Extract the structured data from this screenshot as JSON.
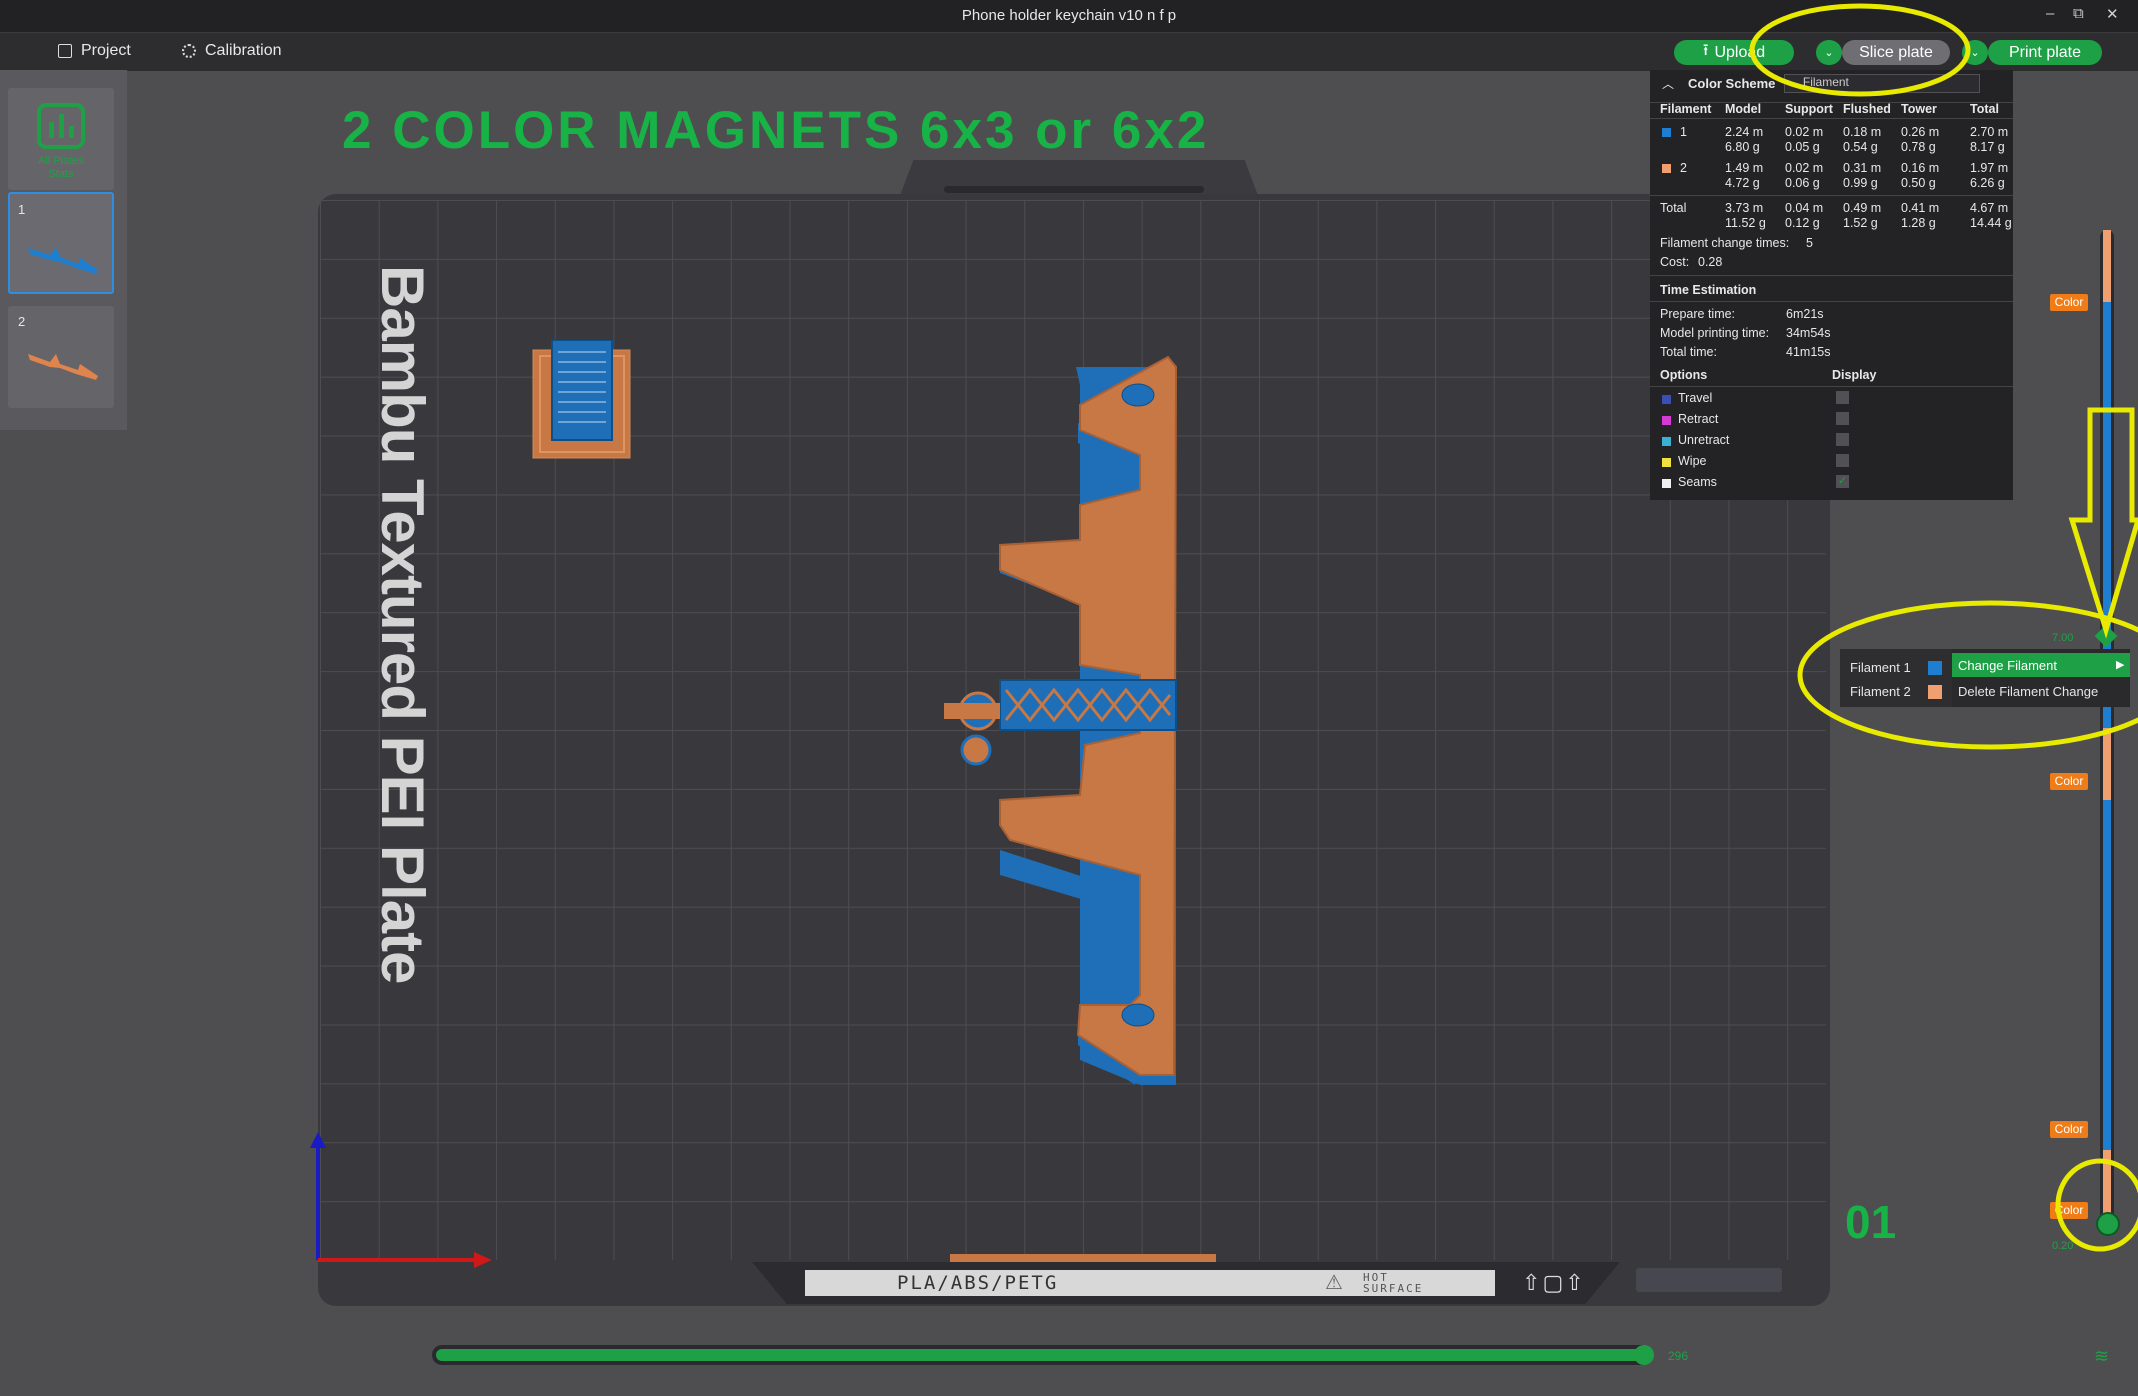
{
  "window": {
    "title": "Phone holder keychain v10 n f p",
    "controls": [
      "–",
      "⧉",
      "✕"
    ]
  },
  "menubar": {
    "project_label": "Project",
    "calibration_label": "Calibration",
    "upload_label": "Upload",
    "slice_label": "Slice plate",
    "print_label": "Print plate"
  },
  "plates": {
    "all_plates_label": "All Plates Stats",
    "items": [
      {
        "number": "1"
      },
      {
        "number": "2"
      }
    ]
  },
  "canvas": {
    "annotation_title": "2 COLOR MAGNETS 6x3 or 6x2",
    "bed_name": "Bambu Textured PEI Plate",
    "plate_number": "01",
    "bed_label_text": "PLA/ABS/PETG",
    "bed_warning_text": "HOT SURFACE"
  },
  "stats": {
    "color_scheme_label": "Color Scheme",
    "color_scheme_value": "Filament",
    "columns": [
      "Filament",
      "Model",
      "Support",
      "Flushed",
      "Tower",
      "Total"
    ],
    "rows": [
      {
        "id": "1",
        "color": "#1e7fd0",
        "model": [
          "2.24 m",
          "6.80 g"
        ],
        "support": [
          "0.02 m",
          "0.05 g"
        ],
        "flushed": [
          "0.18 m",
          "0.54 g"
        ],
        "tower": [
          "0.26 m",
          "0.78 g"
        ],
        "total": [
          "2.70 m",
          "8.17 g"
        ]
      },
      {
        "id": "2",
        "color": "#f0a070",
        "model": [
          "1.49 m",
          "4.72 g"
        ],
        "support": [
          "0.02 m",
          "0.06 g"
        ],
        "flushed": [
          "0.31 m",
          "0.99 g"
        ],
        "tower": [
          "0.16 m",
          "0.50 g"
        ],
        "total": [
          "1.97 m",
          "6.26 g"
        ]
      }
    ],
    "total_row": {
      "label": "Total",
      "model": [
        "3.73 m",
        "11.52 g"
      ],
      "support": [
        "0.04 m",
        "0.12 g"
      ],
      "flushed": [
        "0.49 m",
        "1.52 g"
      ],
      "tower": [
        "0.41 m",
        "1.28 g"
      ],
      "total": [
        "4.67 m",
        "14.44 g"
      ]
    },
    "filament_change_label": "Filament change times:",
    "filament_change_value": "5",
    "cost_label": "Cost:",
    "cost_value": "0.28",
    "time_estimation_label": "Time Estimation",
    "prepare_time_label": "Prepare time:",
    "prepare_time_value": "6m21s",
    "model_time_label": "Model printing time:",
    "model_time_value": "34m54s",
    "total_time_label": "Total time:",
    "total_time_value": "41m15s",
    "options_label": "Options",
    "display_label": "Display",
    "options": [
      {
        "label": "Travel",
        "color": "#3a4fb5",
        "checked": false
      },
      {
        "label": "Retract",
        "color": "#d43ad4",
        "checked": false
      },
      {
        "label": "Unretract",
        "color": "#3ab0d4",
        "checked": false
      },
      {
        "label": "Wipe",
        "color": "#f0e040",
        "checked": false
      },
      {
        "label": "Seams",
        "color": "#f0f0f0",
        "checked": true
      }
    ]
  },
  "layer_slider": {
    "color_tag_label": "Color",
    "top_value": "7.00",
    "bottom_value": "0.20"
  },
  "context_menu": {
    "filament1_label": "Filament 1",
    "filament1_color": "#1e7fd0",
    "filament2_label": "Filament 2",
    "filament2_color": "#f0a070",
    "change_label": "Change Filament",
    "delete_label": "Delete Filament Change"
  },
  "move_slider": {
    "value": "296"
  },
  "colors": {
    "accent": "#1ea146",
    "annotation": "#e8ea00",
    "filament1": "#1e7fd0",
    "filament2": "#c87844",
    "color_tag": "#f07c18"
  }
}
